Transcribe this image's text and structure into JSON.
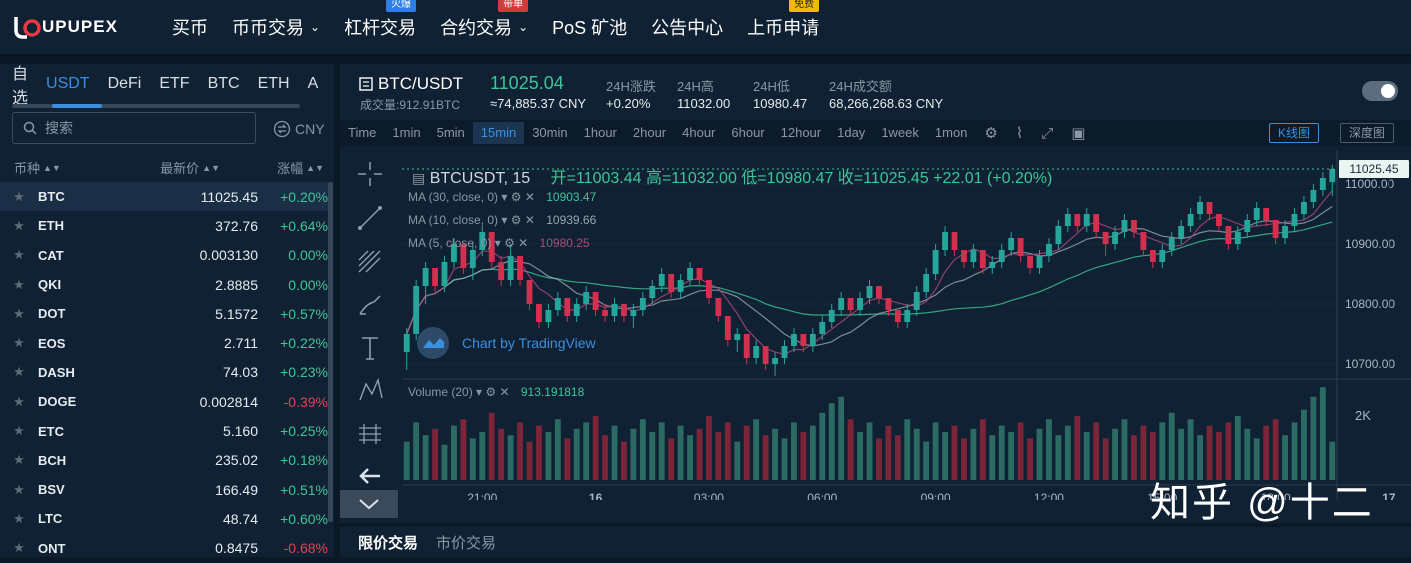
{
  "brand": {
    "name_main": "UPUPEX"
  },
  "nav": [
    {
      "label": "买币",
      "badge": "",
      "badge_color": "",
      "dropdown": false
    },
    {
      "label": "币币交易",
      "badge": "",
      "dropdown": true
    },
    {
      "label": "杠杆交易",
      "badge": "火爆",
      "badge_color": "blue",
      "dropdown": false
    },
    {
      "label": "合约交易",
      "badge": "带单",
      "badge_color": "red",
      "dropdown": true
    },
    {
      "label": "PoS 矿池",
      "badge": "",
      "dropdown": false
    },
    {
      "label": "公告中心",
      "badge": "",
      "dropdown": false
    },
    {
      "label": "上币申请",
      "badge": "免费",
      "badge_color": "yellow",
      "dropdown": false
    }
  ],
  "market": {
    "tabs": [
      "自选",
      "USDT",
      "DeFi",
      "ETF",
      "BTC",
      "ETH",
      "A"
    ],
    "active_tab": "USDT",
    "search_placeholder": "搜索",
    "currency_toggle": "CNY",
    "headers": {
      "symbol": "币种",
      "price": "最新价",
      "change": "涨幅"
    },
    "rows": [
      {
        "sym": "BTC",
        "price": "11025.45",
        "chg": "+0.20%",
        "dir": "up"
      },
      {
        "sym": "ETH",
        "price": "372.76",
        "chg": "+0.64%",
        "dir": "up"
      },
      {
        "sym": "CAT",
        "price": "0.003130",
        "chg": "0.00%",
        "dir": "flat"
      },
      {
        "sym": "QKI",
        "price": "2.8885",
        "chg": "0.00%",
        "dir": "flat"
      },
      {
        "sym": "DOT",
        "price": "5.1572",
        "chg": "+0.57%",
        "dir": "up"
      },
      {
        "sym": "EOS",
        "price": "2.711",
        "chg": "+0.22%",
        "dir": "up"
      },
      {
        "sym": "DASH",
        "price": "74.03",
        "chg": "+0.23%",
        "dir": "up"
      },
      {
        "sym": "DOGE",
        "price": "0.002814",
        "chg": "-0.39%",
        "dir": "down"
      },
      {
        "sym": "ETC",
        "price": "5.160",
        "chg": "+0.25%",
        "dir": "up"
      },
      {
        "sym": "BCH",
        "price": "235.02",
        "chg": "+0.18%",
        "dir": "up"
      },
      {
        "sym": "BSV",
        "price": "166.49",
        "chg": "+0.51%",
        "dir": "up"
      },
      {
        "sym": "LTC",
        "price": "48.74",
        "chg": "+0.60%",
        "dir": "up"
      },
      {
        "sym": "ONT",
        "price": "0.8475",
        "chg": "-0.68%",
        "dir": "down"
      }
    ]
  },
  "ticker": {
    "pair": "BTC/USDT",
    "volume": "成交量:912.91BTC",
    "last": "11025.04",
    "last_cny": "≈74,885.37 CNY",
    "stats": [
      {
        "label": "24H涨跌",
        "value": "+0.20%",
        "color": "up"
      },
      {
        "label": "24H高",
        "value": "11032.00"
      },
      {
        "label": "24H低",
        "value": "10980.47"
      },
      {
        "label": "24H成交额",
        "value": "68,266,268.63 CNY"
      }
    ]
  },
  "intervals": [
    "Time",
    "1min",
    "5min",
    "15min",
    "30min",
    "1hour",
    "2hour",
    "4hour",
    "6hour",
    "12hour",
    "1day",
    "1week",
    "1mon"
  ],
  "active_interval": "15min",
  "view_buttons": {
    "kline": "K线图",
    "depth": "深度图"
  },
  "chart_legend": {
    "symbol": "BTCUSDT, 15",
    "ohlc": "开=11003.44  高=11032.00  低=10980.47  收=11025.45  +22.01 (+0.20%)",
    "ma30": {
      "label": "MA (30, close, 0)",
      "value": "10903.47",
      "color": "#3fc59a"
    },
    "ma10": {
      "label": "MA (10, close, 0)",
      "value": "10939.66",
      "color": "#9aa7b3"
    },
    "ma5": {
      "label": "MA (5, close, 0)",
      "value": "10980.25",
      "color": "#b04a7a"
    },
    "volume_label": "Volume (20)",
    "volume_value": "913.191818",
    "branding": "Chart by TradingView",
    "last_price_tag": "11025.45"
  },
  "chart_data": {
    "type": "candlestick",
    "y_ticks": [
      "11000.00",
      "10900.00",
      "10800.00",
      "10700.00"
    ],
    "y_tick_values": [
      11000,
      10900,
      10800,
      10700
    ],
    "ylim": [
      10680,
      11040
    ],
    "vol_ticks": [
      "2K"
    ],
    "vol_tick_values": [
      2000
    ],
    "vol_ylim": [
      0,
      3000
    ],
    "x_ticks": [
      "21:00",
      "16",
      "03:00",
      "06:00",
      "09:00",
      "12:00",
      "15:00",
      "18:00",
      "17"
    ],
    "x_tick_index": [
      8,
      20,
      32,
      44,
      56,
      68,
      80,
      92,
      104
    ],
    "candles": [
      [
        10720,
        10760,
        10690,
        10750
      ],
      [
        10750,
        10840,
        10740,
        10830
      ],
      [
        10830,
        10870,
        10800,
        10860
      ],
      [
        10860,
        10850,
        10820,
        10830
      ],
      [
        10830,
        10880,
        10820,
        10870
      ],
      [
        10870,
        10910,
        10860,
        10900
      ],
      [
        10900,
        10880,
        10850,
        10860
      ],
      [
        10860,
        10900,
        10840,
        10890
      ],
      [
        10890,
        10930,
        10880,
        10920
      ],
      [
        10920,
        10900,
        10860,
        10870
      ],
      [
        10870,
        10880,
        10830,
        10840
      ],
      [
        10840,
        10900,
        10830,
        10880
      ],
      [
        10880,
        10870,
        10830,
        10840
      ],
      [
        10840,
        10830,
        10790,
        10800
      ],
      [
        10800,
        10780,
        10760,
        10770
      ],
      [
        10770,
        10800,
        10760,
        10790
      ],
      [
        10790,
        10820,
        10780,
        10810
      ],
      [
        10810,
        10790,
        10770,
        10780
      ],
      [
        10780,
        10810,
        10770,
        10800
      ],
      [
        10800,
        10830,
        10790,
        10820
      ],
      [
        10820,
        10800,
        10780,
        10790
      ],
      [
        10790,
        10800,
        10770,
        10780
      ],
      [
        10780,
        10810,
        10770,
        10800
      ],
      [
        10800,
        10790,
        10770,
        10780
      ],
      [
        10780,
        10800,
        10760,
        10790
      ],
      [
        10790,
        10820,
        10780,
        10810
      ],
      [
        10810,
        10840,
        10800,
        10830
      ],
      [
        10830,
        10860,
        10820,
        10850
      ],
      [
        10850,
        10840,
        10810,
        10820
      ],
      [
        10820,
        10850,
        10810,
        10840
      ],
      [
        10840,
        10870,
        10830,
        10860
      ],
      [
        10860,
        10850,
        10830,
        10840
      ],
      [
        10840,
        10830,
        10800,
        10810
      ],
      [
        10810,
        10800,
        10770,
        10780
      ],
      [
        10780,
        10760,
        10730,
        10740
      ],
      [
        10740,
        10760,
        10720,
        10750
      ],
      [
        10750,
        10730,
        10700,
        10710
      ],
      [
        10710,
        10740,
        10700,
        10730
      ],
      [
        10730,
        10720,
        10690,
        10700
      ],
      [
        10700,
        10720,
        10680,
        10710
      ],
      [
        10710,
        10740,
        10700,
        10730
      ],
      [
        10730,
        10760,
        10720,
        10750
      ],
      [
        10750,
        10740,
        10720,
        10730
      ],
      [
        10730,
        10760,
        10720,
        10750
      ],
      [
        10750,
        10780,
        10740,
        10770
      ],
      [
        10770,
        10800,
        10760,
        10790
      ],
      [
        10790,
        10820,
        10780,
        10810
      ],
      [
        10810,
        10800,
        10780,
        10790
      ],
      [
        10790,
        10820,
        10780,
        10810
      ],
      [
        10810,
        10840,
        10800,
        10830
      ],
      [
        10830,
        10820,
        10800,
        10810
      ],
      [
        10810,
        10800,
        10780,
        10790
      ],
      [
        10790,
        10780,
        10760,
        10770
      ],
      [
        10770,
        10800,
        10760,
        10790
      ],
      [
        10790,
        10830,
        10780,
        10820
      ],
      [
        10820,
        10860,
        10810,
        10850
      ],
      [
        10850,
        10900,
        10840,
        10890
      ],
      [
        10890,
        10930,
        10880,
        10920
      ],
      [
        10920,
        10910,
        10880,
        10890
      ],
      [
        10890,
        10880,
        10860,
        10870
      ],
      [
        10870,
        10900,
        10860,
        10890
      ],
      [
        10890,
        10880,
        10850,
        10860
      ],
      [
        10860,
        10880,
        10850,
        10870
      ],
      [
        10870,
        10900,
        10860,
        10890
      ],
      [
        10890,
        10920,
        10880,
        10910
      ],
      [
        10910,
        10900,
        10870,
        10880
      ],
      [
        10880,
        10870,
        10850,
        10860
      ],
      [
        10860,
        10890,
        10850,
        10880
      ],
      [
        10880,
        10910,
        10870,
        10900
      ],
      [
        10900,
        10940,
        10890,
        10930
      ],
      [
        10930,
        10960,
        10920,
        10950
      ],
      [
        10950,
        10940,
        10920,
        10930
      ],
      [
        10930,
        10960,
        10920,
        10950
      ],
      [
        10950,
        10940,
        10910,
        10920
      ],
      [
        10920,
        10910,
        10880,
        10900
      ],
      [
        10900,
        10930,
        10890,
        10920
      ],
      [
        10920,
        10950,
        10910,
        10940
      ],
      [
        10940,
        10930,
        10910,
        10920
      ],
      [
        10920,
        10910,
        10880,
        10890
      ],
      [
        10890,
        10880,
        10860,
        10870
      ],
      [
        10870,
        10900,
        10860,
        10890
      ],
      [
        10890,
        10920,
        10880,
        10910
      ],
      [
        10910,
        10940,
        10900,
        10930
      ],
      [
        10930,
        10960,
        10920,
        10950
      ],
      [
        10950,
        10980,
        10940,
        10970
      ],
      [
        10970,
        10960,
        10940,
        10950
      ],
      [
        10950,
        10940,
        10920,
        10930
      ],
      [
        10930,
        10920,
        10890,
        10900
      ],
      [
        10900,
        10930,
        10890,
        10920
      ],
      [
        10920,
        10950,
        10910,
        10940
      ],
      [
        10940,
        10970,
        10930,
        10960
      ],
      [
        10960,
        10950,
        10930,
        10940
      ],
      [
        10940,
        10930,
        10900,
        10910
      ],
      [
        10910,
        10940,
        10900,
        10930
      ],
      [
        10930,
        10960,
        10920,
        10950
      ],
      [
        10950,
        10980,
        10940,
        10970
      ],
      [
        10970,
        11000,
        10960,
        10990
      ],
      [
        10990,
        11020,
        10980,
        11010
      ],
      [
        11003,
        11032,
        10980,
        11025
      ]
    ],
    "volumes": [
      1200,
      1800,
      1400,
      1600,
      1100,
      1700,
      1900,
      1300,
      1500,
      2100,
      1600,
      1400,
      1800,
      1200,
      1700,
      1500,
      1900,
      1300,
      1600,
      1800,
      2000,
      1400,
      1700,
      1200,
      1600,
      1900,
      1500,
      1800,
      1300,
      1700,
      1400,
      1600,
      2000,
      1500,
      1800,
      1200,
      1700,
      1900,
      1400,
      1600,
      1300,
      1800,
      1500,
      1700,
      2100,
      2400,
      2600,
      1900,
      1500,
      1800,
      1300,
      1700,
      1400,
      1900,
      1600,
      1200,
      1800,
      1500,
      1700,
      1300,
      1600,
      1900,
      1400,
      1700,
      1500,
      1800,
      1300,
      1600,
      1900,
      1400,
      1700,
      2000,
      1500,
      1800,
      1300,
      1600,
      1900,
      1400,
      1700,
      1500,
      1800,
      2100,
      1600,
      1900,
      1400,
      1700,
      1500,
      1800,
      2000,
      1600,
      1300,
      1700,
      1900,
      1400,
      1800,
      2200,
      2600,
      2900,
      1200
    ],
    "ma5_color": "#b04a7a",
    "ma10_color": "#9aa7b3",
    "ma30_color": "#3fc59a",
    "up_color": "#26a69a",
    "down_color": "#d32f4f"
  },
  "order_tabs": [
    "限价交易",
    "市价交易"
  ],
  "watermark": "知乎 @十二"
}
